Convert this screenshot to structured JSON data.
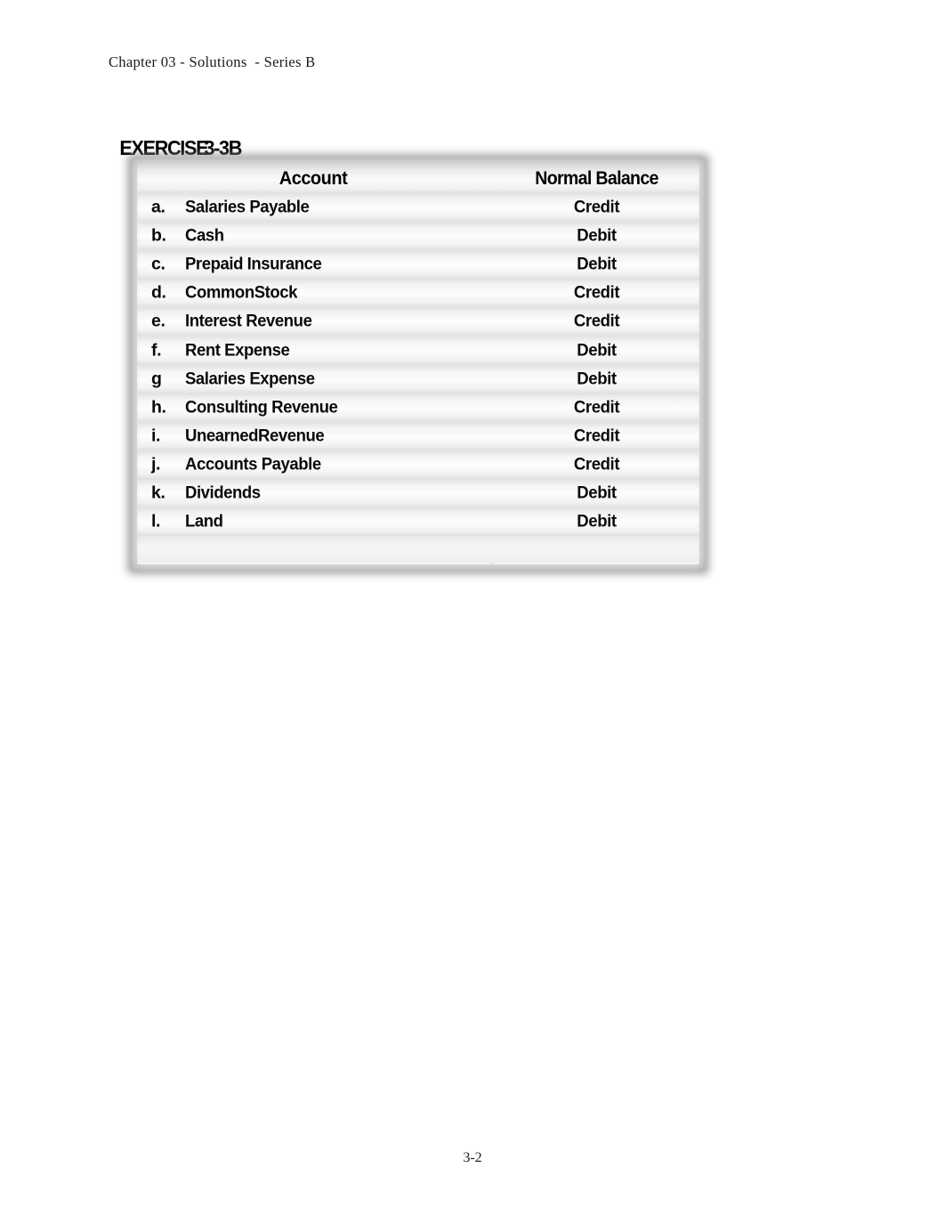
{
  "header": {
    "running_head": "Chapter 03 - Solutions  - Series B"
  },
  "title": {
    "exercise_word": "EXERCISE",
    "exercise_number": "3-3B",
    "full": "EXERCISE 3-3B"
  },
  "table": {
    "columns": [
      {
        "key": "account",
        "label": "Account"
      },
      {
        "key": "balance",
        "label": "Normal Balance"
      }
    ],
    "rows": [
      {
        "letter": "a.",
        "account": "Salaries Payable",
        "balance": "Credit"
      },
      {
        "letter": "b.",
        "account": "Cash",
        "balance": "Debit"
      },
      {
        "letter": "c.",
        "account": "Prepaid Insurance",
        "balance": "Debit"
      },
      {
        "letter": "d.",
        "account": "CommonStock",
        "balance": "Credit"
      },
      {
        "letter": "e.",
        "account": "Interest Revenue",
        "balance": "Credit"
      },
      {
        "letter": "f.",
        "account": "Rent Expense",
        "balance": "Debit"
      },
      {
        "letter": "g",
        "account": "Salaries Expense",
        "balance": "Debit"
      },
      {
        "letter": "h.",
        "account": "Consulting Revenue",
        "balance": "Credit"
      },
      {
        "letter": "i.",
        "account": "UnearnedRevenue",
        "balance": "Credit"
      },
      {
        "letter": "j.",
        "account": "Accounts Payable",
        "balance": "Credit"
      },
      {
        "letter": "k.",
        "account": "Dividends",
        "balance": "Debit"
      },
      {
        "letter": "l.",
        "account": "Land",
        "balance": "Debit"
      }
    ]
  },
  "footer": {
    "page_number": "3-2"
  },
  "colors": {
    "text": "#0a0a0a",
    "table_border": "#8e8e8e",
    "row_light": "#fdfdfd",
    "row_shade": "#e2e2e2"
  }
}
